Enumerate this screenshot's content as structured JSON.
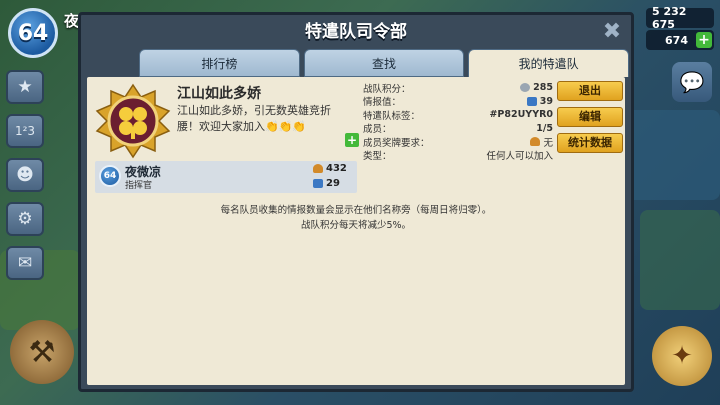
{
  "player": {
    "level": "64",
    "name_peek": "夜"
  },
  "resources": {
    "gold": "5 232 675",
    "gems": "674"
  },
  "dialog": {
    "title": "特遣队司令部",
    "close_glyph": "✖",
    "tabs": [
      {
        "label": "排行榜",
        "active": false
      },
      {
        "label": "查找",
        "active": false
      },
      {
        "label": "我的特遣队",
        "active": true
      }
    ]
  },
  "team": {
    "name": "江山如此多娇",
    "description": "江山如此多娇，引无数英雄竞折腰！欢迎大家加入👏👏👏",
    "info": [
      {
        "label": "战队积分：",
        "value": "285",
        "icon": "points-icon"
      },
      {
        "label": "情报值：",
        "value": "39",
        "icon": "intel-icon"
      },
      {
        "label": "特遣队标签：",
        "value": "#P82UYYR0",
        "icon": ""
      },
      {
        "label": "成员：",
        "value": "1/5",
        "icon": ""
      },
      {
        "label": "成员奖牌要求：",
        "value": "无",
        "icon": "medal-icon"
      },
      {
        "label": "类型：",
        "value": "任何人可以加入",
        "icon": ""
      }
    ]
  },
  "actions": {
    "leave": "退出",
    "edit": "编辑",
    "stats": "统计数据"
  },
  "member": {
    "level": "64",
    "name": "夜微凉",
    "role": "指挥官",
    "medals": "432",
    "intel": "29"
  },
  "notice": {
    "line1": "每名队员收集的情报数量会显示在他们名称旁（每周日将归零）。",
    "line2": "战队积分每天将减少5%。"
  },
  "colors": {
    "accent_gold": "#f2c040",
    "panel_bg": "#efe9d6",
    "frame": "#3a4a5a"
  }
}
